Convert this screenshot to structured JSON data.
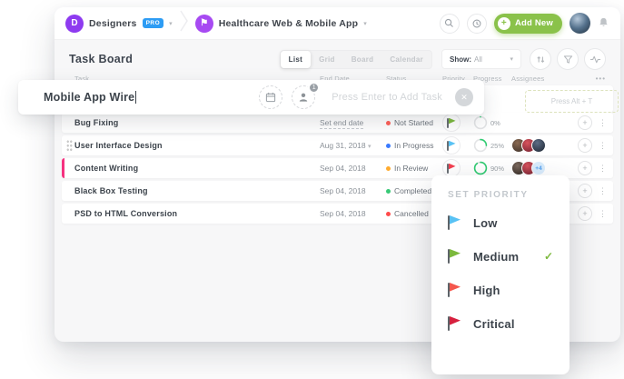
{
  "breadcrumb": {
    "team_initial": "D",
    "team_name": "Designers",
    "team_badge": "PRO",
    "project_name": "Healthcare Web & Mobile App"
  },
  "topbar": {
    "add_new": "Add New"
  },
  "toolbar": {
    "title": "Task Board",
    "tabs": {
      "list": "List",
      "grid": "Grid",
      "board": "Board",
      "calendar": "Calendar"
    },
    "show_label": "Show:",
    "show_value": "All"
  },
  "table_head": {
    "task": "Task",
    "end_date": "End Date",
    "status": "Status",
    "priority": "Priority",
    "progress": "Progress",
    "assignees": "Assignees",
    "more": "•••"
  },
  "add_task": {
    "value": "Mobile App Wire",
    "placeholder": "Press Enter to Add Task",
    "assignee_count": "1",
    "shortcut_hint": "Press Alt + T"
  },
  "rows": [
    {
      "task": "Bug Fixing",
      "end_date": "Set end date",
      "status": "Not Started",
      "status_color": "#ff6058",
      "flag_color": "#7cb93d",
      "progress": 0,
      "progress_label": "0%"
    },
    {
      "task": "User Interface Design",
      "end_date": "Aug 31, 2018",
      "date_caret": "▾",
      "status": "In Progress",
      "status_color": "#3a7afe",
      "flag_color": "#59c2f4",
      "progress": 25,
      "progress_label": "25%"
    },
    {
      "task": "Content Writing",
      "end_date": "Sep 04, 2018",
      "status": "In Review",
      "status_color": "#ffab2e",
      "flag_color": "#f43f4f",
      "progress": 90,
      "progress_label": "90%",
      "extra": "+4",
      "accent_color": "#f5317f"
    },
    {
      "task": "Black Box Testing",
      "end_date": "Sep 04, 2018",
      "status": "Completed",
      "status_color": "#38c976"
    },
    {
      "task": "PSD to HTML Conversion",
      "end_date": "Sep 04, 2018",
      "status": "Cancelled",
      "status_color": "#ff4b4b"
    }
  ],
  "priority_menu": {
    "title": "SET PRIORITY",
    "check": "✓",
    "items": [
      {
        "label": "Low",
        "color": "#59c2f4"
      },
      {
        "label": "Medium",
        "color": "#7cb93d",
        "selected": true
      },
      {
        "label": "High",
        "color": "#f4574d"
      },
      {
        "label": "Critical",
        "color": "#d6203e"
      }
    ]
  },
  "icons": {
    "caret_down": "▾",
    "dots_v": "⋮",
    "plus": "+",
    "close": "✕"
  }
}
